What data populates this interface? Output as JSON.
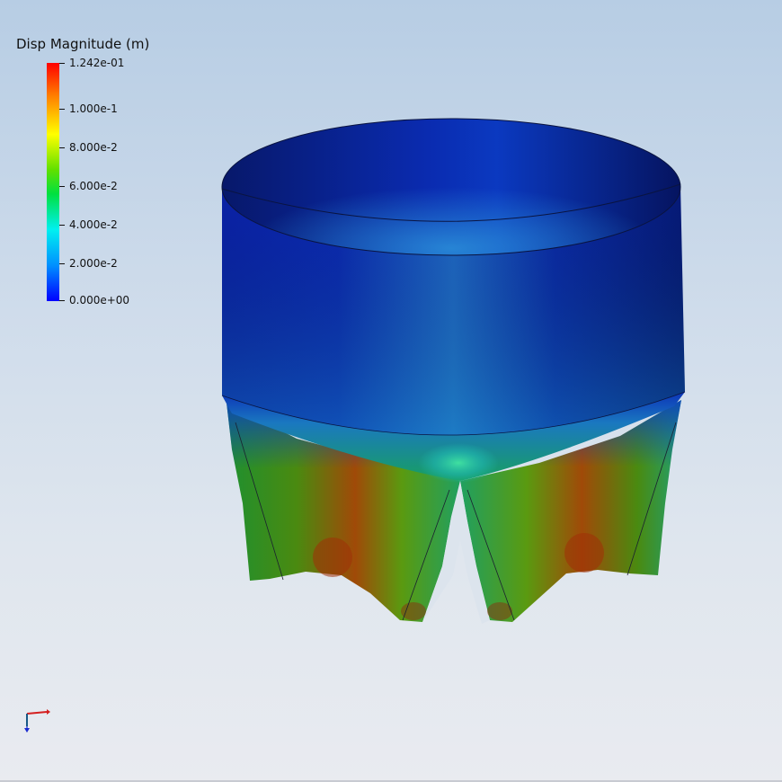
{
  "legend": {
    "title": "Disp Magnitude (m)",
    "labels": [
      "1.242e-01",
      "1.000e-1",
      "8.000e-2",
      "6.000e-2",
      "4.000e-2",
      "2.000e-2",
      "0.000e+00"
    ],
    "min": 0,
    "max": 0.1242,
    "colormap": [
      "#ff0000",
      "#ff8000",
      "#ffff00",
      "#80ff00",
      "#00ff40",
      "#00ffff",
      "#0080ff",
      "#0000ff"
    ]
  },
  "model": {
    "description_colors": {
      "low": "#0a1f9c",
      "mid": "#2fd3a0",
      "high": "#b33a0c"
    }
  },
  "triad": {
    "x_color": "#d42020",
    "y_color": "#18a018",
    "z_color": "#1a2ad0"
  }
}
